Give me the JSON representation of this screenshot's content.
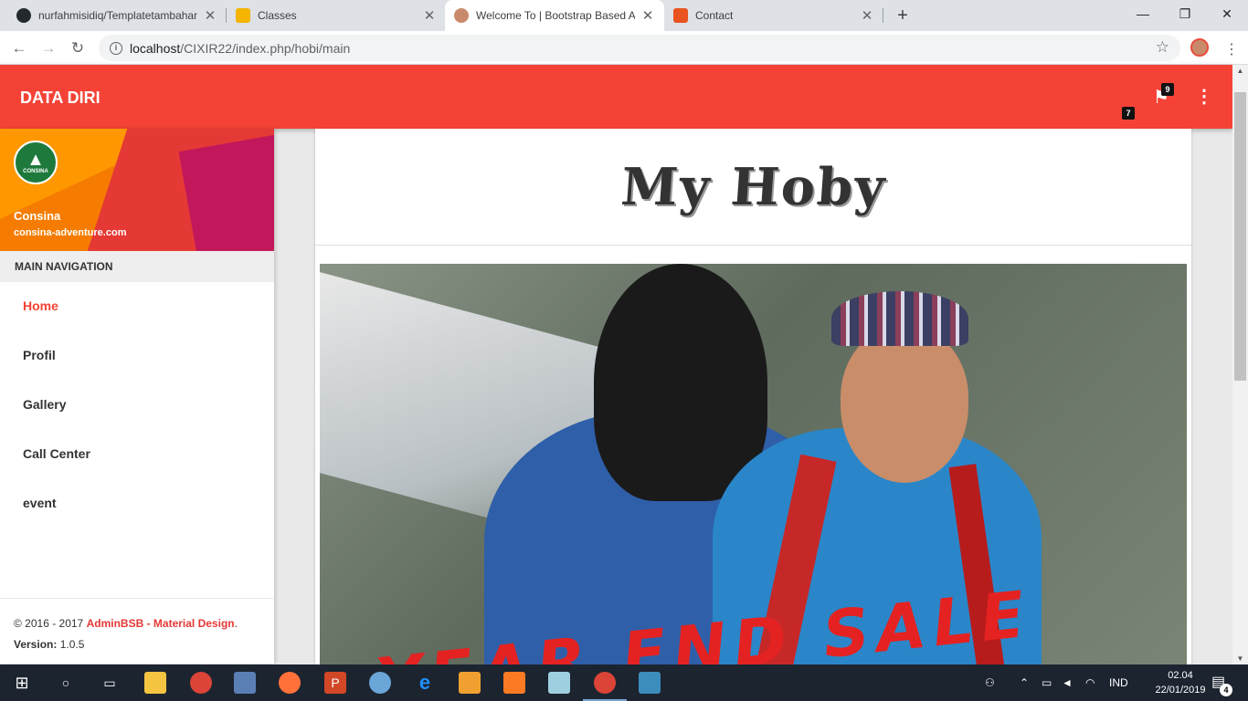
{
  "browser": {
    "tabs": [
      {
        "title": "nurfahmisidiq/Templatetambahan",
        "icon": "github-icon",
        "color": "#24292e"
      },
      {
        "title": "Classes",
        "icon": "classroom-icon",
        "color": "#f4b400"
      },
      {
        "title": "Welcome To | Bootstrap Based Admin",
        "icon": "avatar-icon",
        "color": "#c98a6b"
      },
      {
        "title": "Contact",
        "icon": "codeigniter-icon",
        "color": "#e8531f"
      }
    ],
    "new_tab_icon": "plus-icon",
    "window_controls": [
      "minimize",
      "maximize",
      "close"
    ],
    "url_host": "localhost",
    "url_path": "/CIXIR22/index.php/hobi/main"
  },
  "app": {
    "brand": "DATA DIRI",
    "notifications": {
      "flag_count": "9",
      "secondary_count": "7"
    }
  },
  "sidebar": {
    "user_name": "Consina",
    "user_site": "consina-adventure.com",
    "logo_text": "CONSINA",
    "nav_header": "MAIN NAVIGATION",
    "items": [
      {
        "label": "Home",
        "active": true
      },
      {
        "label": "Profil"
      },
      {
        "label": "Gallery"
      },
      {
        "label": "Call Center"
      },
      {
        "label": "event"
      }
    ],
    "footer": {
      "copyright": "© 2016 - 2017 ",
      "link": "AdminBSB - Material Design",
      "period": ".",
      "version_label": "Version:",
      "version": "1.0.5"
    }
  },
  "main": {
    "title": "My Hoby",
    "banner_text": "YEAR END SALE"
  },
  "taskbar": {
    "tray_lang": "IND",
    "time": "02.04",
    "date": "22/01/2019",
    "notification_count": "4"
  },
  "colors": {
    "primary": "#f44336",
    "active_link": "#f44336"
  }
}
